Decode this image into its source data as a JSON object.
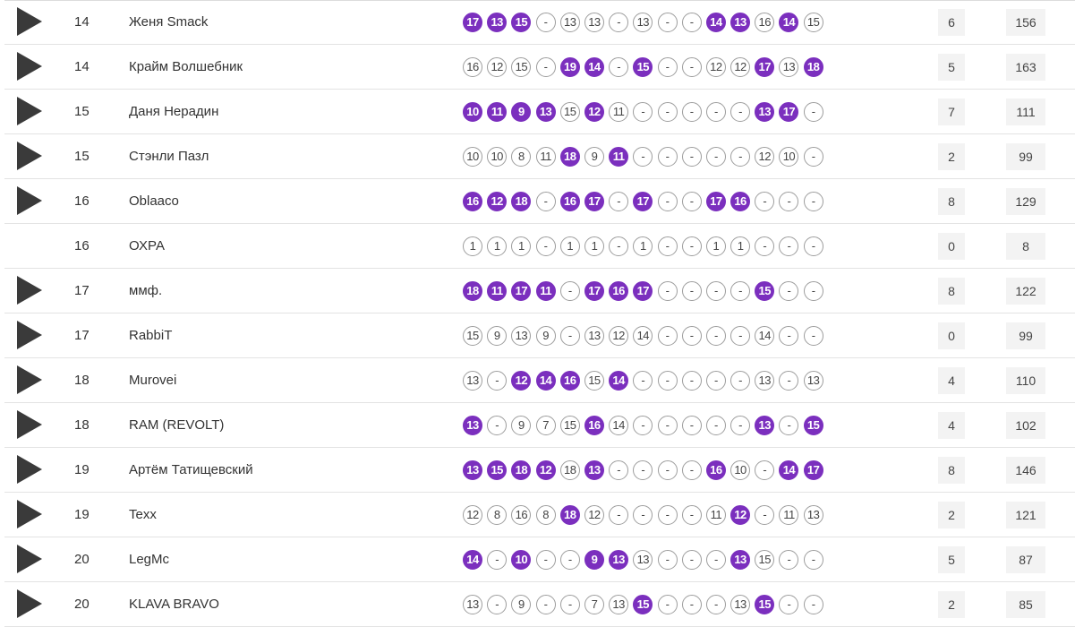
{
  "rows": [
    {
      "place": "14",
      "name": "Женя Smack",
      "play": true,
      "count": "6",
      "total": "156",
      "scores": [
        {
          "v": "17",
          "h": 1
        },
        {
          "v": "13",
          "h": 1
        },
        {
          "v": "15",
          "h": 1
        },
        {
          "v": "-",
          "h": 0
        },
        {
          "v": "13",
          "h": 0
        },
        {
          "v": "13",
          "h": 0
        },
        {
          "v": "-",
          "h": 0
        },
        {
          "v": "13",
          "h": 0
        },
        {
          "v": "-",
          "h": 0
        },
        {
          "v": "-",
          "h": 0
        },
        {
          "v": "14",
          "h": 1
        },
        {
          "v": "13",
          "h": 1
        },
        {
          "v": "16",
          "h": 0
        },
        {
          "v": "14",
          "h": 1
        },
        {
          "v": "15",
          "h": 0
        }
      ]
    },
    {
      "place": "14",
      "name": "Крайм Волшебник",
      "play": true,
      "count": "5",
      "total": "163",
      "scores": [
        {
          "v": "16",
          "h": 0
        },
        {
          "v": "12",
          "h": 0
        },
        {
          "v": "15",
          "h": 0
        },
        {
          "v": "-",
          "h": 0
        },
        {
          "v": "19",
          "h": 1
        },
        {
          "v": "14",
          "h": 1
        },
        {
          "v": "-",
          "h": 0
        },
        {
          "v": "15",
          "h": 1
        },
        {
          "v": "-",
          "h": 0
        },
        {
          "v": "-",
          "h": 0
        },
        {
          "v": "12",
          "h": 0
        },
        {
          "v": "12",
          "h": 0
        },
        {
          "v": "17",
          "h": 1
        },
        {
          "v": "13",
          "h": 0
        },
        {
          "v": "18",
          "h": 1
        }
      ]
    },
    {
      "place": "15",
      "name": "Даня Нерадин",
      "play": true,
      "count": "7",
      "total": "111",
      "scores": [
        {
          "v": "10",
          "h": 1
        },
        {
          "v": "11",
          "h": 1
        },
        {
          "v": "9",
          "h": 1
        },
        {
          "v": "13",
          "h": 1
        },
        {
          "v": "15",
          "h": 0
        },
        {
          "v": "12",
          "h": 1
        },
        {
          "v": "11",
          "h": 0
        },
        {
          "v": "-",
          "h": 0
        },
        {
          "v": "-",
          "h": 0
        },
        {
          "v": "-",
          "h": 0
        },
        {
          "v": "-",
          "h": 0
        },
        {
          "v": "-",
          "h": 0
        },
        {
          "v": "13",
          "h": 1
        },
        {
          "v": "17",
          "h": 1
        },
        {
          "v": "-",
          "h": 0
        }
      ]
    },
    {
      "place": "15",
      "name": "Стэнли Пазл",
      "play": true,
      "count": "2",
      "total": "99",
      "scores": [
        {
          "v": "10",
          "h": 0
        },
        {
          "v": "10",
          "h": 0
        },
        {
          "v": "8",
          "h": 0
        },
        {
          "v": "11",
          "h": 0
        },
        {
          "v": "18",
          "h": 1
        },
        {
          "v": "9",
          "h": 0
        },
        {
          "v": "11",
          "h": 1
        },
        {
          "v": "-",
          "h": 0
        },
        {
          "v": "-",
          "h": 0
        },
        {
          "v": "-",
          "h": 0
        },
        {
          "v": "-",
          "h": 0
        },
        {
          "v": "-",
          "h": 0
        },
        {
          "v": "12",
          "h": 0
        },
        {
          "v": "10",
          "h": 0
        },
        {
          "v": "-",
          "h": 0
        }
      ]
    },
    {
      "place": "16",
      "name": "Oblaaco",
      "play": true,
      "count": "8",
      "total": "129",
      "scores": [
        {
          "v": "16",
          "h": 1
        },
        {
          "v": "12",
          "h": 1
        },
        {
          "v": "18",
          "h": 1
        },
        {
          "v": "-",
          "h": 0
        },
        {
          "v": "16",
          "h": 1
        },
        {
          "v": "17",
          "h": 1
        },
        {
          "v": "-",
          "h": 0
        },
        {
          "v": "17",
          "h": 1
        },
        {
          "v": "-",
          "h": 0
        },
        {
          "v": "-",
          "h": 0
        },
        {
          "v": "17",
          "h": 1
        },
        {
          "v": "16",
          "h": 1
        },
        {
          "v": "-",
          "h": 0
        },
        {
          "v": "-",
          "h": 0
        },
        {
          "v": "-",
          "h": 0
        }
      ]
    },
    {
      "place": "16",
      "name": "ОХРА",
      "play": false,
      "count": "0",
      "total": "8",
      "scores": [
        {
          "v": "1",
          "h": 0
        },
        {
          "v": "1",
          "h": 0
        },
        {
          "v": "1",
          "h": 0
        },
        {
          "v": "-",
          "h": 0
        },
        {
          "v": "1",
          "h": 0
        },
        {
          "v": "1",
          "h": 0
        },
        {
          "v": "-",
          "h": 0
        },
        {
          "v": "1",
          "h": 0
        },
        {
          "v": "-",
          "h": 0
        },
        {
          "v": "-",
          "h": 0
        },
        {
          "v": "1",
          "h": 0
        },
        {
          "v": "1",
          "h": 0
        },
        {
          "v": "-",
          "h": 0
        },
        {
          "v": "-",
          "h": 0
        },
        {
          "v": "-",
          "h": 0
        }
      ]
    },
    {
      "place": "17",
      "name": "ммф.",
      "play": true,
      "count": "8",
      "total": "122",
      "scores": [
        {
          "v": "18",
          "h": 1
        },
        {
          "v": "11",
          "h": 1
        },
        {
          "v": "17",
          "h": 1
        },
        {
          "v": "11",
          "h": 1
        },
        {
          "v": "-",
          "h": 0
        },
        {
          "v": "17",
          "h": 1
        },
        {
          "v": "16",
          "h": 1
        },
        {
          "v": "17",
          "h": 1
        },
        {
          "v": "-",
          "h": 0
        },
        {
          "v": "-",
          "h": 0
        },
        {
          "v": "-",
          "h": 0
        },
        {
          "v": "-",
          "h": 0
        },
        {
          "v": "15",
          "h": 1
        },
        {
          "v": "-",
          "h": 0
        },
        {
          "v": "-",
          "h": 0
        }
      ]
    },
    {
      "place": "17",
      "name": "RabbiT",
      "play": true,
      "count": "0",
      "total": "99",
      "scores": [
        {
          "v": "15",
          "h": 0
        },
        {
          "v": "9",
          "h": 0
        },
        {
          "v": "13",
          "h": 0
        },
        {
          "v": "9",
          "h": 0
        },
        {
          "v": "-",
          "h": 0
        },
        {
          "v": "13",
          "h": 0
        },
        {
          "v": "12",
          "h": 0
        },
        {
          "v": "14",
          "h": 0
        },
        {
          "v": "-",
          "h": 0
        },
        {
          "v": "-",
          "h": 0
        },
        {
          "v": "-",
          "h": 0
        },
        {
          "v": "-",
          "h": 0
        },
        {
          "v": "14",
          "h": 0
        },
        {
          "v": "-",
          "h": 0
        },
        {
          "v": "-",
          "h": 0
        }
      ]
    },
    {
      "place": "18",
      "name": "Murovei",
      "play": true,
      "count": "4",
      "total": "110",
      "scores": [
        {
          "v": "13",
          "h": 0
        },
        {
          "v": "-",
          "h": 0
        },
        {
          "v": "12",
          "h": 1
        },
        {
          "v": "14",
          "h": 1
        },
        {
          "v": "16",
          "h": 1
        },
        {
          "v": "15",
          "h": 0
        },
        {
          "v": "14",
          "h": 1
        },
        {
          "v": "-",
          "h": 0
        },
        {
          "v": "-",
          "h": 0
        },
        {
          "v": "-",
          "h": 0
        },
        {
          "v": "-",
          "h": 0
        },
        {
          "v": "-",
          "h": 0
        },
        {
          "v": "13",
          "h": 0
        },
        {
          "v": "-",
          "h": 0
        },
        {
          "v": "13",
          "h": 0
        }
      ]
    },
    {
      "place": "18",
      "name": "RAM (REVOLT)",
      "play": true,
      "count": "4",
      "total": "102",
      "scores": [
        {
          "v": "13",
          "h": 1
        },
        {
          "v": "-",
          "h": 0
        },
        {
          "v": "9",
          "h": 0
        },
        {
          "v": "7",
          "h": 0
        },
        {
          "v": "15",
          "h": 0
        },
        {
          "v": "16",
          "h": 1
        },
        {
          "v": "14",
          "h": 0
        },
        {
          "v": "-",
          "h": 0
        },
        {
          "v": "-",
          "h": 0
        },
        {
          "v": "-",
          "h": 0
        },
        {
          "v": "-",
          "h": 0
        },
        {
          "v": "-",
          "h": 0
        },
        {
          "v": "13",
          "h": 1
        },
        {
          "v": "-",
          "h": 0
        },
        {
          "v": "15",
          "h": 1
        }
      ]
    },
    {
      "place": "19",
      "name": "Артём Татищевский",
      "play": true,
      "count": "8",
      "total": "146",
      "scores": [
        {
          "v": "13",
          "h": 1
        },
        {
          "v": "15",
          "h": 1
        },
        {
          "v": "18",
          "h": 1
        },
        {
          "v": "12",
          "h": 1
        },
        {
          "v": "18",
          "h": 0
        },
        {
          "v": "13",
          "h": 1
        },
        {
          "v": "-",
          "h": 0
        },
        {
          "v": "-",
          "h": 0
        },
        {
          "v": "-",
          "h": 0
        },
        {
          "v": "-",
          "h": 0
        },
        {
          "v": "16",
          "h": 1
        },
        {
          "v": "10",
          "h": 0
        },
        {
          "v": "-",
          "h": 0
        },
        {
          "v": "14",
          "h": 1
        },
        {
          "v": "17",
          "h": 1
        }
      ]
    },
    {
      "place": "19",
      "name": "Texx",
      "play": true,
      "count": "2",
      "total": "121",
      "scores": [
        {
          "v": "12",
          "h": 0
        },
        {
          "v": "8",
          "h": 0
        },
        {
          "v": "16",
          "h": 0
        },
        {
          "v": "8",
          "h": 0
        },
        {
          "v": "18",
          "h": 1
        },
        {
          "v": "12",
          "h": 0
        },
        {
          "v": "-",
          "h": 0
        },
        {
          "v": "-",
          "h": 0
        },
        {
          "v": "-",
          "h": 0
        },
        {
          "v": "-",
          "h": 0
        },
        {
          "v": "11",
          "h": 0
        },
        {
          "v": "12",
          "h": 1
        },
        {
          "v": "-",
          "h": 0
        },
        {
          "v": "11",
          "h": 0
        },
        {
          "v": "13",
          "h": 0
        }
      ]
    },
    {
      "place": "20",
      "name": "LegMc",
      "play": true,
      "count": "5",
      "total": "87",
      "scores": [
        {
          "v": "14",
          "h": 1
        },
        {
          "v": "-",
          "h": 0
        },
        {
          "v": "10",
          "h": 1
        },
        {
          "v": "-",
          "h": 0
        },
        {
          "v": "-",
          "h": 0
        },
        {
          "v": "9",
          "h": 1
        },
        {
          "v": "13",
          "h": 1
        },
        {
          "v": "13",
          "h": 0
        },
        {
          "v": "-",
          "h": 0
        },
        {
          "v": "-",
          "h": 0
        },
        {
          "v": "-",
          "h": 0
        },
        {
          "v": "13",
          "h": 1
        },
        {
          "v": "15",
          "h": 0
        },
        {
          "v": "-",
          "h": 0
        },
        {
          "v": "-",
          "h": 0
        }
      ]
    },
    {
      "place": "20",
      "name": "KLAVA BRAVO",
      "play": true,
      "count": "2",
      "total": "85",
      "scores": [
        {
          "v": "13",
          "h": 0
        },
        {
          "v": "-",
          "h": 0
        },
        {
          "v": "9",
          "h": 0
        },
        {
          "v": "-",
          "h": 0
        },
        {
          "v": "-",
          "h": 0
        },
        {
          "v": "7",
          "h": 0
        },
        {
          "v": "13",
          "h": 0
        },
        {
          "v": "15",
          "h": 1
        },
        {
          "v": "-",
          "h": 0
        },
        {
          "v": "-",
          "h": 0
        },
        {
          "v": "-",
          "h": 0
        },
        {
          "v": "13",
          "h": 0
        },
        {
          "v": "15",
          "h": 1
        },
        {
          "v": "-",
          "h": 0
        },
        {
          "v": "-",
          "h": 0
        }
      ]
    }
  ],
  "icons": {
    "play": "play-triangle-icon"
  },
  "colors": {
    "highlight": "#7b2fbe",
    "play_icon": "#3a3a3a",
    "box_bg": "#f3f3f3"
  }
}
